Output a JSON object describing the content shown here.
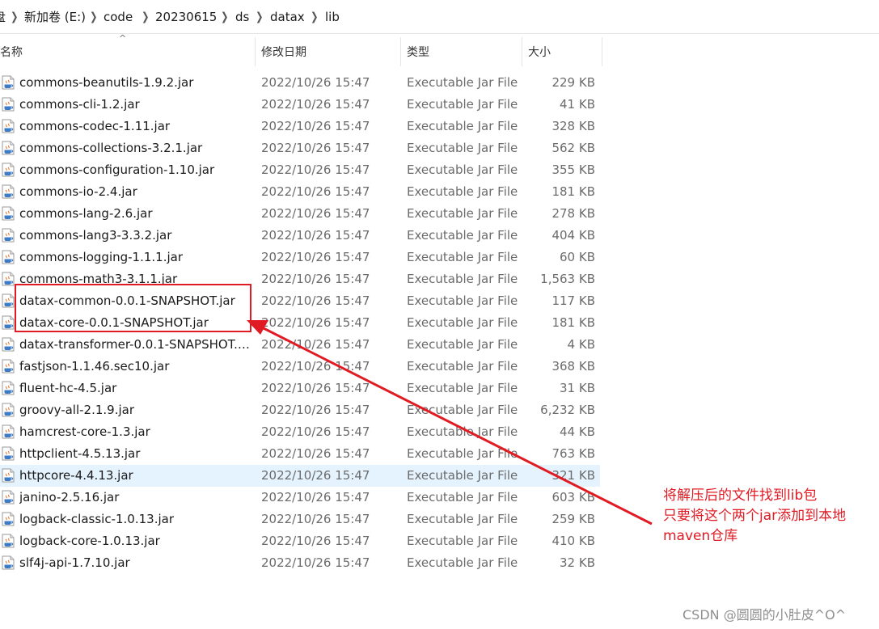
{
  "breadcrumb": {
    "items": [
      "盘",
      "新加卷 (E:)",
      "code",
      "20230615",
      "ds",
      "datax",
      "lib"
    ]
  },
  "columns": {
    "name": "名称",
    "date": "修改日期",
    "type": "类型",
    "size": "大小"
  },
  "files": [
    {
      "name": "commons-beanutils-1.9.2.jar",
      "date": "2022/10/26 15:47",
      "type": "Executable Jar File",
      "size": "229 KB"
    },
    {
      "name": "commons-cli-1.2.jar",
      "date": "2022/10/26 15:47",
      "type": "Executable Jar File",
      "size": "41 KB"
    },
    {
      "name": "commons-codec-1.11.jar",
      "date": "2022/10/26 15:47",
      "type": "Executable Jar File",
      "size": "328 KB"
    },
    {
      "name": "commons-collections-3.2.1.jar",
      "date": "2022/10/26 15:47",
      "type": "Executable Jar File",
      "size": "562 KB"
    },
    {
      "name": "commons-configuration-1.10.jar",
      "date": "2022/10/26 15:47",
      "type": "Executable Jar File",
      "size": "355 KB"
    },
    {
      "name": "commons-io-2.4.jar",
      "date": "2022/10/26 15:47",
      "type": "Executable Jar File",
      "size": "181 KB"
    },
    {
      "name": "commons-lang-2.6.jar",
      "date": "2022/10/26 15:47",
      "type": "Executable Jar File",
      "size": "278 KB"
    },
    {
      "name": "commons-lang3-3.3.2.jar",
      "date": "2022/10/26 15:47",
      "type": "Executable Jar File",
      "size": "404 KB"
    },
    {
      "name": "commons-logging-1.1.1.jar",
      "date": "2022/10/26 15:47",
      "type": "Executable Jar File",
      "size": "60 KB"
    },
    {
      "name": "commons-math3-3.1.1.jar",
      "date": "2022/10/26 15:47",
      "type": "Executable Jar File",
      "size": "1,563 KB"
    },
    {
      "name": "datax-common-0.0.1-SNAPSHOT.jar",
      "date": "2022/10/26 15:47",
      "type": "Executable Jar File",
      "size": "117 KB"
    },
    {
      "name": "datax-core-0.0.1-SNAPSHOT.jar",
      "date": "2022/10/26 15:47",
      "type": "Executable Jar File",
      "size": "181 KB"
    },
    {
      "name": "datax-transformer-0.0.1-SNAPSHOT.j...",
      "date": "2022/10/26 15:47",
      "type": "Executable Jar File",
      "size": "4 KB"
    },
    {
      "name": "fastjson-1.1.46.sec10.jar",
      "date": "2022/10/26 15:47",
      "type": "Executable Jar File",
      "size": "368 KB"
    },
    {
      "name": "fluent-hc-4.5.jar",
      "date": "2022/10/26 15:47",
      "type": "Executable Jar File",
      "size": "31 KB"
    },
    {
      "name": "groovy-all-2.1.9.jar",
      "date": "2022/10/26 15:47",
      "type": "Executable Jar File",
      "size": "6,232 KB"
    },
    {
      "name": "hamcrest-core-1.3.jar",
      "date": "2022/10/26 15:47",
      "type": "Executable Jar File",
      "size": "44 KB"
    },
    {
      "name": "httpclient-4.5.13.jar",
      "date": "2022/10/26 15:47",
      "type": "Executable Jar File",
      "size": "763 KB"
    },
    {
      "name": "httpcore-4.4.13.jar",
      "date": "2022/10/26 15:47",
      "type": "Executable Jar File",
      "size": "321 KB",
      "selected": true
    },
    {
      "name": "janino-2.5.16.jar",
      "date": "2022/10/26 15:47",
      "type": "Executable Jar File",
      "size": "603 KB"
    },
    {
      "name": "logback-classic-1.0.13.jar",
      "date": "2022/10/26 15:47",
      "type": "Executable Jar File",
      "size": "259 KB"
    },
    {
      "name": "logback-core-1.0.13.jar",
      "date": "2022/10/26 15:47",
      "type": "Executable Jar File",
      "size": "410 KB"
    },
    {
      "name": "slf4j-api-1.7.10.jar",
      "date": "2022/10/26 15:47",
      "type": "Executable Jar File",
      "size": "32 KB"
    }
  ],
  "annotation": {
    "lines": [
      "将解压后的文件找到lib包",
      "只要将这个两个jar添加到本地",
      "maven仓库"
    ],
    "color": "#e01b24"
  },
  "watermark": "CSDN @圆圆的小肚皮^O^"
}
